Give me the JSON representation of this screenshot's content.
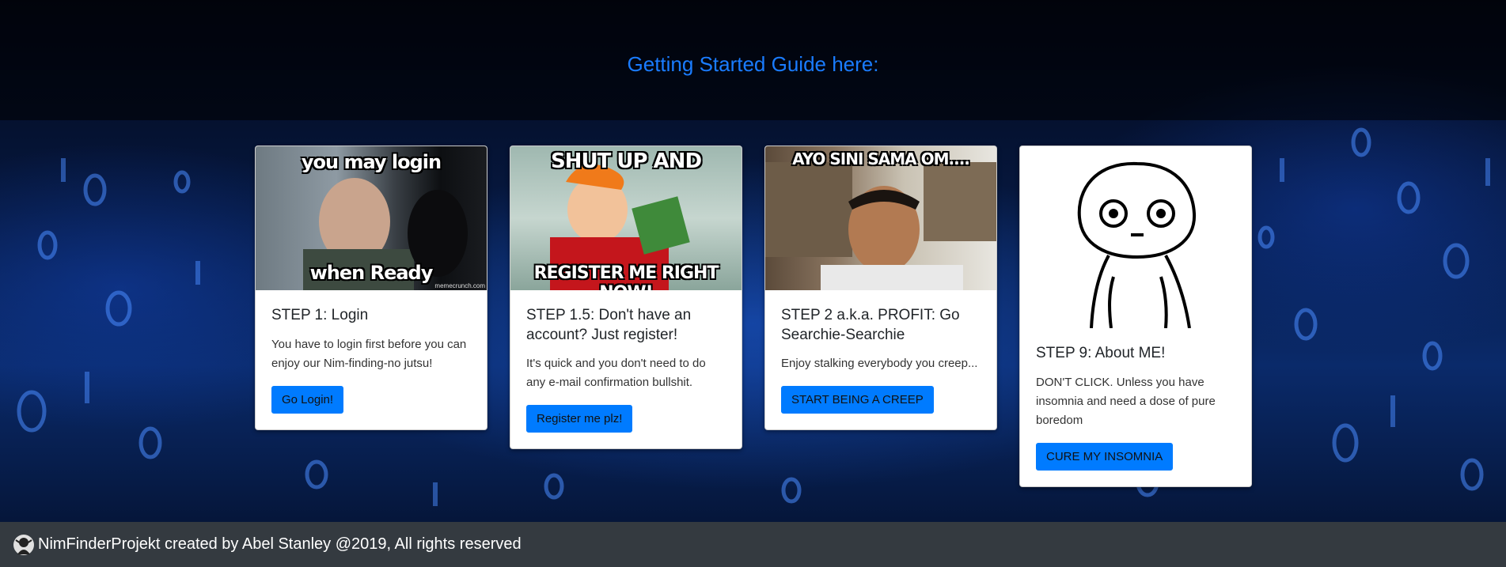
{
  "header": {
    "title": "Getting Started Guide here:"
  },
  "cards": [
    {
      "image_caption_top": "you may login",
      "image_caption_bottom": "when Ready",
      "image_watermark": "memecrunch.com",
      "title": "STEP 1: Login",
      "text": "You have to login first before you can enjoy our Nim-finding-no jutsu!",
      "button": "Go Login!"
    },
    {
      "image_caption_top": "SHUT UP AND",
      "image_caption_bottom": "REGISTER ME RIGHT NOW!",
      "title": "STEP 1.5: Don't have an account? Just register!",
      "text": "It's quick and you don't need to do any e-mail confirmation bullshit.",
      "button": "Register me plz!"
    },
    {
      "image_caption_top": "AYO SINI SAMA OM....",
      "title": "STEP 2 a.k.a. PROFIT: Go Searchie-Searchie",
      "text": "Enjoy stalking everybody you creep...",
      "button": "START BEING A CREEP"
    },
    {
      "title": "STEP 9: About ME!",
      "text": "DON'T CLICK. Unless you have insomnia and need a dose of pure boredom",
      "button": "CURE MY INSOMNIA"
    }
  ],
  "footer": {
    "text": "NimFinderProjekt created by Abel Stanley @2019, All rights reserved"
  },
  "colors": {
    "accent": "#007bff",
    "title": "#1a7cff",
    "footer_bg": "#343a40"
  }
}
